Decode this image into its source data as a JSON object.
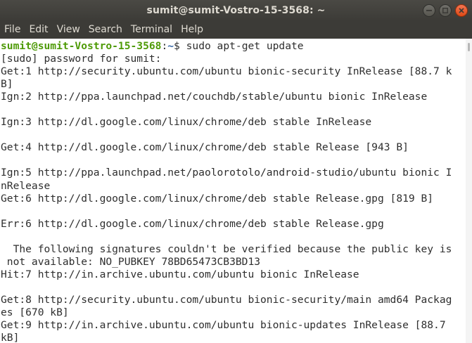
{
  "window": {
    "title": "sumit@sumit-Vostro-15-3568: ~"
  },
  "menu": [
    "File",
    "Edit",
    "View",
    "Search",
    "Terminal",
    "Help"
  ],
  "prompt": {
    "user_host": "sumit@sumit-Vostro-15-3568",
    "separator": ":",
    "path": "~",
    "symbol": "$ ",
    "command": "sudo apt-get update"
  },
  "output": [
    "[sudo] password for sumit:",
    "Get:1 http://security.ubuntu.com/ubuntu bionic-security InRelease [88.7 k",
    "B]",
    "Ign:2 http://ppa.launchpad.net/couchdb/stable/ubuntu bionic InRelease",
    "",
    "Ign:3 http://dl.google.com/linux/chrome/deb stable InRelease",
    "",
    "Get:4 http://dl.google.com/linux/chrome/deb stable Release [943 B]",
    "",
    "Ign:5 http://ppa.launchpad.net/paolorotolo/android-studio/ubuntu bionic I",
    "nRelease",
    "Get:6 http://dl.google.com/linux/chrome/deb stable Release.gpg [819 B]",
    "",
    "Err:6 http://dl.google.com/linux/chrome/deb stable Release.gpg",
    "",
    "  The following signatures couldn't be verified because the public key is",
    " not available: NO_PUBKEY 78BD65473CB3BD13",
    "Hit:7 http://in.archive.ubuntu.com/ubuntu bionic InRelease",
    "",
    "Get:8 http://security.ubuntu.com/ubuntu bionic-security/main amd64 Packag",
    "es [670 kB]",
    "Get:9 http://in.archive.ubuntu.com/ubuntu bionic-updates InRelease [88.7",
    "kB]"
  ]
}
